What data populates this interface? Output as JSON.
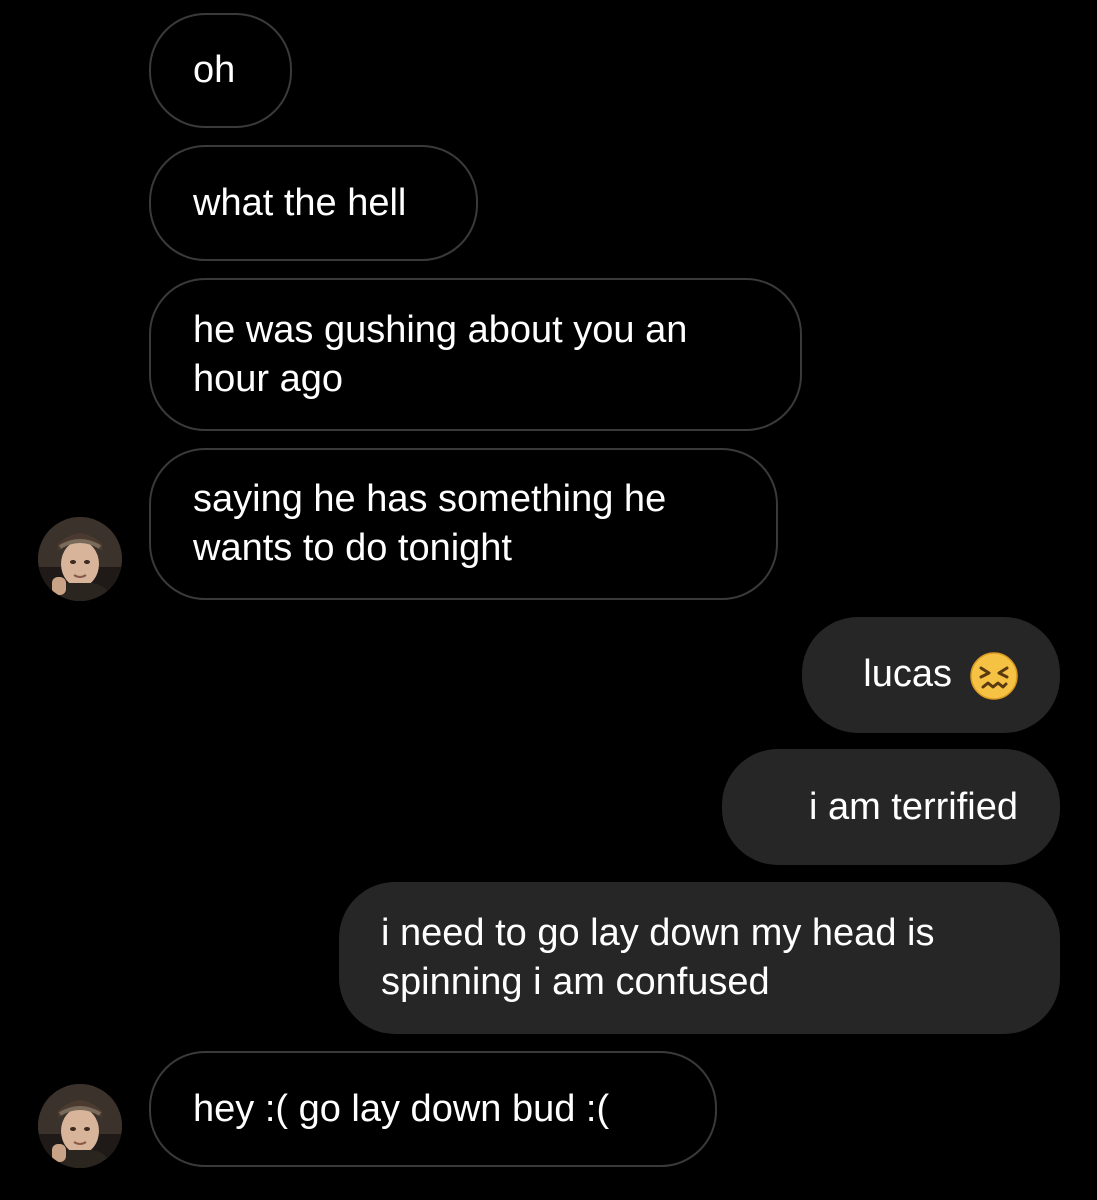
{
  "messages": [
    {
      "side": "incoming",
      "text": "oh"
    },
    {
      "side": "incoming",
      "text": "what the hell"
    },
    {
      "side": "incoming",
      "lines": [
        "he was gushing about you an",
        "hour ago"
      ]
    },
    {
      "side": "incoming",
      "lines": [
        "saying he has something he",
        "wants to do tonight"
      ]
    },
    {
      "side": "outgoing",
      "text": "lucas",
      "emoji": "confounded-face"
    },
    {
      "side": "outgoing",
      "text": "i am terrified"
    },
    {
      "side": "outgoing",
      "lines": [
        "i need to go lay down my head is",
        "spinning i am confused"
      ]
    },
    {
      "side": "incoming",
      "text": "hey :( go lay down bud :("
    }
  ],
  "avatar": {
    "icon": "profile-avatar",
    "alt": "contact avatar"
  },
  "colors": {
    "background": "#000000",
    "incoming_border": "#3a3a3a",
    "outgoing_fill": "#262626",
    "text": "#ffffff"
  }
}
